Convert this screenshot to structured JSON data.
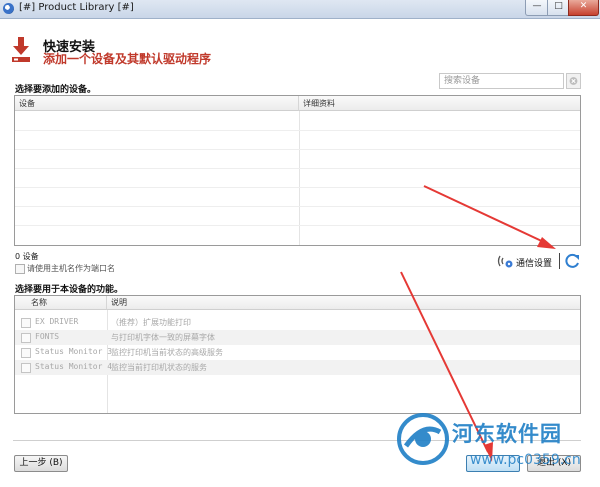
{
  "window": {
    "title": "[#] Product Library [#]",
    "min_glyph": "—",
    "max_glyph": "□",
    "close_glyph": "✕"
  },
  "header": {
    "title": "快速安装",
    "subtitle": "添加一个设备及其默认驱动程序"
  },
  "search": {
    "placeholder": "搜索设备"
  },
  "devices": {
    "section_label": "选择要添加的设备。",
    "columns": [
      "设备",
      "详细资料"
    ],
    "count_text": "0 设备",
    "use_host_label": "请使用主机名作为端口名"
  },
  "comm": {
    "label": "通信设置"
  },
  "functions": {
    "section_label": "选择要用于本设备的功能。",
    "columns": [
      "名称",
      "说明"
    ],
    "rows": [
      {
        "name": "EX DRIVER",
        "desc": "（推荐）扩展功能打印"
      },
      {
        "name": "FONTS",
        "desc": "与打印机字体一致的屏幕字体"
      },
      {
        "name": "Status Monitor 3",
        "desc": "监控打印机当前状态的高级服务"
      },
      {
        "name": "Status Monitor 4",
        "desc": "监控当前打印机状态的服务"
      }
    ]
  },
  "buttons": {
    "prev": "上一步 (B)",
    "next": "",
    "exit": "退出 (X)"
  },
  "watermark": {
    "text": "河东软件园",
    "url": "www.pc0359.cn"
  },
  "colors": {
    "accent_red": "#c0392b",
    "watermark_blue": "#1f7fc6",
    "arrow_red": "#e53935"
  }
}
